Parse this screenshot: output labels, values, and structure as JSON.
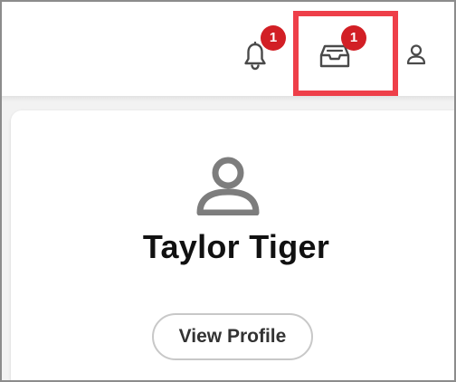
{
  "header": {
    "notifications": {
      "icon": "bell-icon",
      "badge_count": "1"
    },
    "inbox": {
      "icon": "inbox-tray-icon",
      "badge_count": "1"
    },
    "account": {
      "icon": "user-icon"
    }
  },
  "profile_card": {
    "avatar_icon": "person-avatar-icon",
    "name": "Taylor Tiger",
    "view_profile_label": "View Profile"
  },
  "colors": {
    "badge": "#d21f25",
    "highlight": "#ee3f49",
    "icon_gray": "#4a4a4a",
    "avatar_gray": "#7d7d7d"
  }
}
